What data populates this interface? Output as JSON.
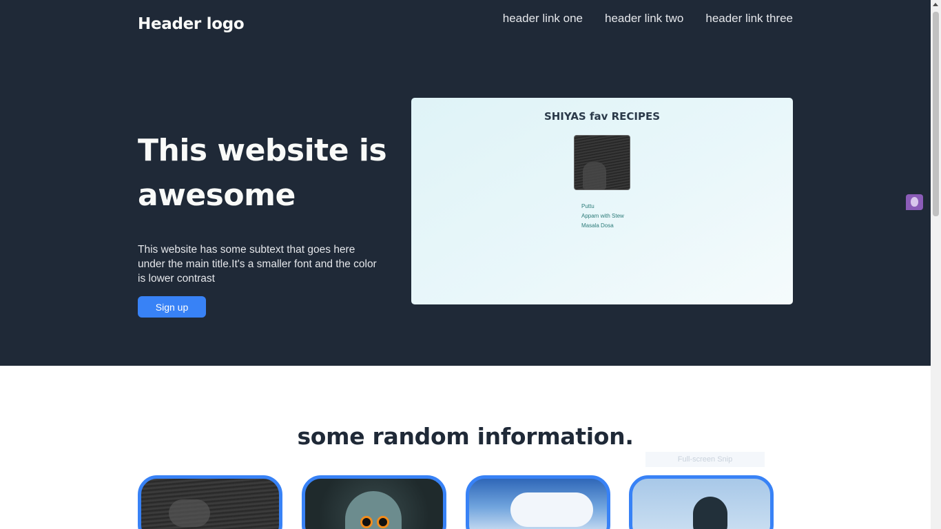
{
  "header": {
    "logo": "Header logo",
    "links": [
      "header link one",
      "header link two",
      "header link three"
    ]
  },
  "hero": {
    "title": "This website is awesome",
    "subtitle": "This website has some subtext that goes here under the main title.It's a smaller font and the color is lower contrast",
    "signup_label": "Sign up",
    "preview": {
      "title": "SHIYAS fav RECIPES",
      "items": [
        "Puttu",
        "Appam with Stew",
        "Masala Dosa"
      ]
    }
  },
  "info": {
    "title": "some random information.",
    "snip_label": "Full-screen Snip"
  },
  "colors": {
    "hero_bg": "#1f2937",
    "accent": "#3882f6"
  }
}
